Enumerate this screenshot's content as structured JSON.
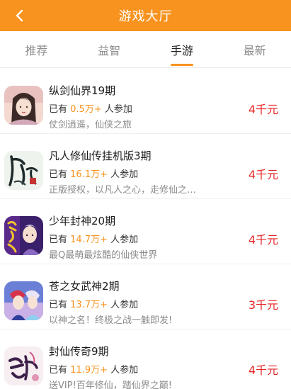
{
  "header": {
    "title": "游戏大厅",
    "back_icon": "chevron-left-icon"
  },
  "tabs": [
    {
      "label": "推荐",
      "active": false
    },
    {
      "label": "益智",
      "active": false
    },
    {
      "label": "手游",
      "active": true
    },
    {
      "label": "最新",
      "active": false
    }
  ],
  "games": [
    {
      "name": "纵剑仙界19期",
      "prefix": "已有",
      "count": "0.5万+",
      "suffix": "人参加",
      "desc": "仗剑逍遥，仙侠之旅",
      "prize": "4千元"
    },
    {
      "name": "凡人修仙传挂机版3期",
      "prefix": "已有",
      "count": "16.1万+",
      "suffix": "人参加",
      "desc": "正版授权，以凡人之心，走修仙之…",
      "prize": "4千元"
    },
    {
      "name": "少年封神20期",
      "prefix": "已有",
      "count": "14.7万+",
      "suffix": "人参加",
      "desc": "最Q最萌最炫酷的仙侠世界",
      "prize": "4千元"
    },
    {
      "name": "苍之女武神2期",
      "prefix": "已有",
      "count": "13.7万+",
      "suffix": "人参加",
      "desc": "以神之名！终极之战一触即发!",
      "prize": "3千元"
    },
    {
      "name": "封仙传奇9期",
      "prefix": "已有",
      "count": "11.9万+",
      "suffix": "人参加",
      "desc": "送VIP!百年修仙，踏仙界之巅!",
      "prize": "4千元"
    }
  ],
  "colors": {
    "accent": "#f7931e",
    "prize": "#e62424"
  }
}
